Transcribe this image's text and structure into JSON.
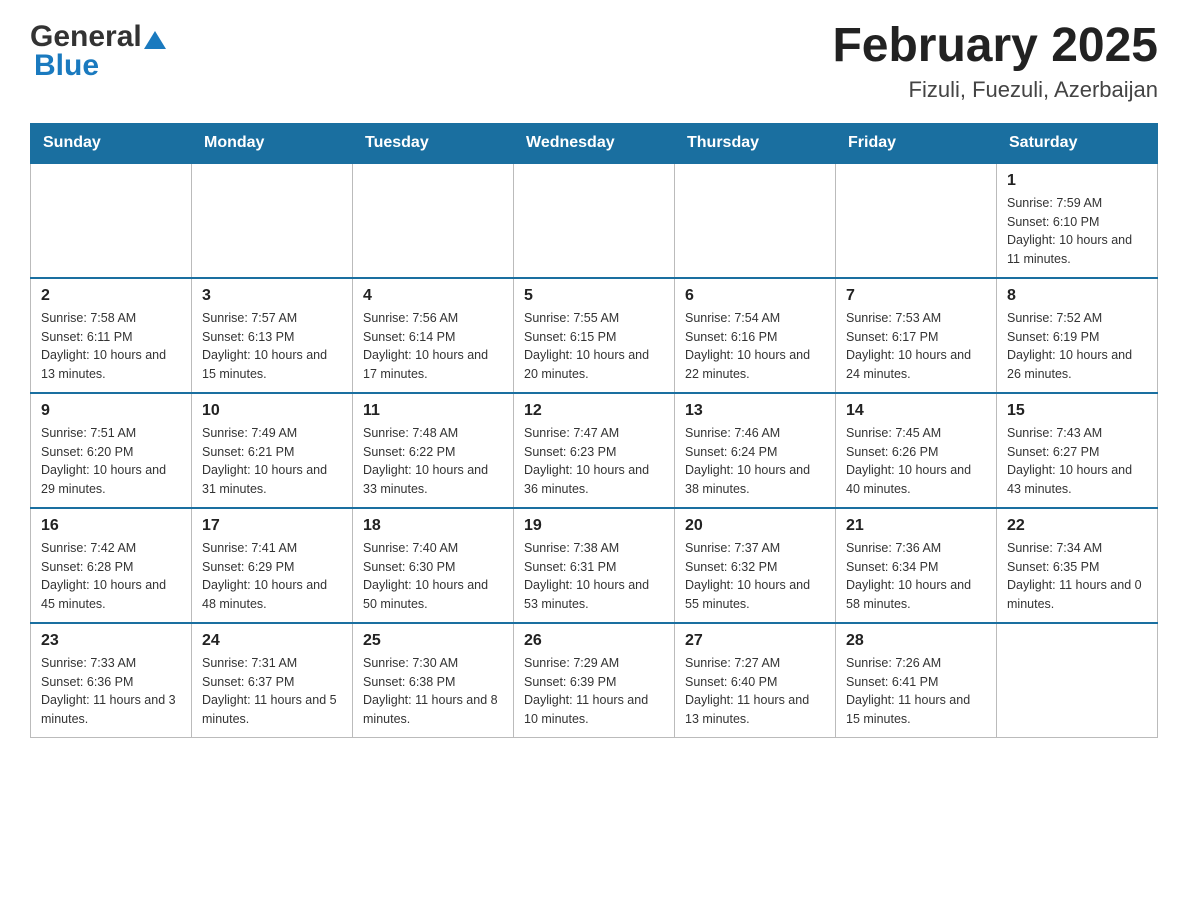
{
  "logo": {
    "general": "General",
    "blue": "Blue"
  },
  "header": {
    "title": "February 2025",
    "subtitle": "Fizuli, Fuezuli, Azerbaijan"
  },
  "days_of_week": [
    "Sunday",
    "Monday",
    "Tuesday",
    "Wednesday",
    "Thursday",
    "Friday",
    "Saturday"
  ],
  "weeks": [
    {
      "days": [
        {
          "num": "",
          "info": ""
        },
        {
          "num": "",
          "info": ""
        },
        {
          "num": "",
          "info": ""
        },
        {
          "num": "",
          "info": ""
        },
        {
          "num": "",
          "info": ""
        },
        {
          "num": "",
          "info": ""
        },
        {
          "num": "1",
          "info": "Sunrise: 7:59 AM\nSunset: 6:10 PM\nDaylight: 10 hours and 11 minutes."
        }
      ]
    },
    {
      "days": [
        {
          "num": "2",
          "info": "Sunrise: 7:58 AM\nSunset: 6:11 PM\nDaylight: 10 hours and 13 minutes."
        },
        {
          "num": "3",
          "info": "Sunrise: 7:57 AM\nSunset: 6:13 PM\nDaylight: 10 hours and 15 minutes."
        },
        {
          "num": "4",
          "info": "Sunrise: 7:56 AM\nSunset: 6:14 PM\nDaylight: 10 hours and 17 minutes."
        },
        {
          "num": "5",
          "info": "Sunrise: 7:55 AM\nSunset: 6:15 PM\nDaylight: 10 hours and 20 minutes."
        },
        {
          "num": "6",
          "info": "Sunrise: 7:54 AM\nSunset: 6:16 PM\nDaylight: 10 hours and 22 minutes."
        },
        {
          "num": "7",
          "info": "Sunrise: 7:53 AM\nSunset: 6:17 PM\nDaylight: 10 hours and 24 minutes."
        },
        {
          "num": "8",
          "info": "Sunrise: 7:52 AM\nSunset: 6:19 PM\nDaylight: 10 hours and 26 minutes."
        }
      ]
    },
    {
      "days": [
        {
          "num": "9",
          "info": "Sunrise: 7:51 AM\nSunset: 6:20 PM\nDaylight: 10 hours and 29 minutes."
        },
        {
          "num": "10",
          "info": "Sunrise: 7:49 AM\nSunset: 6:21 PM\nDaylight: 10 hours and 31 minutes."
        },
        {
          "num": "11",
          "info": "Sunrise: 7:48 AM\nSunset: 6:22 PM\nDaylight: 10 hours and 33 minutes."
        },
        {
          "num": "12",
          "info": "Sunrise: 7:47 AM\nSunset: 6:23 PM\nDaylight: 10 hours and 36 minutes."
        },
        {
          "num": "13",
          "info": "Sunrise: 7:46 AM\nSunset: 6:24 PM\nDaylight: 10 hours and 38 minutes."
        },
        {
          "num": "14",
          "info": "Sunrise: 7:45 AM\nSunset: 6:26 PM\nDaylight: 10 hours and 40 minutes."
        },
        {
          "num": "15",
          "info": "Sunrise: 7:43 AM\nSunset: 6:27 PM\nDaylight: 10 hours and 43 minutes."
        }
      ]
    },
    {
      "days": [
        {
          "num": "16",
          "info": "Sunrise: 7:42 AM\nSunset: 6:28 PM\nDaylight: 10 hours and 45 minutes."
        },
        {
          "num": "17",
          "info": "Sunrise: 7:41 AM\nSunset: 6:29 PM\nDaylight: 10 hours and 48 minutes."
        },
        {
          "num": "18",
          "info": "Sunrise: 7:40 AM\nSunset: 6:30 PM\nDaylight: 10 hours and 50 minutes."
        },
        {
          "num": "19",
          "info": "Sunrise: 7:38 AM\nSunset: 6:31 PM\nDaylight: 10 hours and 53 minutes."
        },
        {
          "num": "20",
          "info": "Sunrise: 7:37 AM\nSunset: 6:32 PM\nDaylight: 10 hours and 55 minutes."
        },
        {
          "num": "21",
          "info": "Sunrise: 7:36 AM\nSunset: 6:34 PM\nDaylight: 10 hours and 58 minutes."
        },
        {
          "num": "22",
          "info": "Sunrise: 7:34 AM\nSunset: 6:35 PM\nDaylight: 11 hours and 0 minutes."
        }
      ]
    },
    {
      "days": [
        {
          "num": "23",
          "info": "Sunrise: 7:33 AM\nSunset: 6:36 PM\nDaylight: 11 hours and 3 minutes."
        },
        {
          "num": "24",
          "info": "Sunrise: 7:31 AM\nSunset: 6:37 PM\nDaylight: 11 hours and 5 minutes."
        },
        {
          "num": "25",
          "info": "Sunrise: 7:30 AM\nSunset: 6:38 PM\nDaylight: 11 hours and 8 minutes."
        },
        {
          "num": "26",
          "info": "Sunrise: 7:29 AM\nSunset: 6:39 PM\nDaylight: 11 hours and 10 minutes."
        },
        {
          "num": "27",
          "info": "Sunrise: 7:27 AM\nSunset: 6:40 PM\nDaylight: 11 hours and 13 minutes."
        },
        {
          "num": "28",
          "info": "Sunrise: 7:26 AM\nSunset: 6:41 PM\nDaylight: 11 hours and 15 minutes."
        },
        {
          "num": "",
          "info": ""
        }
      ]
    }
  ]
}
